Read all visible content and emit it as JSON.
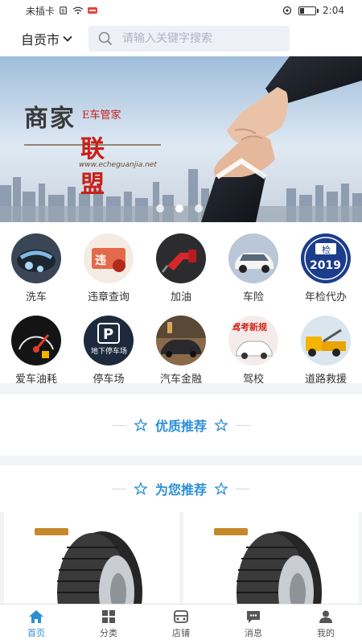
{
  "status_bar": {
    "carrier": "未插卡",
    "time": "2:04",
    "battery_level": 0.3
  },
  "header": {
    "city": "自贡市",
    "search_placeholder": "请输入关键字搜索"
  },
  "banner": {
    "brand_main": "商家",
    "brand_sub": "E车管家",
    "brand_main2": "联盟",
    "brand_url": "www.echeguanjia.net",
    "slide_count": 3,
    "active_slide": 1
  },
  "services": [
    {
      "label": "洗车",
      "icon": "car-wash-icon"
    },
    {
      "label": "违章查询",
      "icon": "violation-icon"
    },
    {
      "label": "加油",
      "icon": "fuel-nozzle-icon"
    },
    {
      "label": "车险",
      "icon": "car-insurance-icon"
    },
    {
      "label": "年检代办",
      "icon": "annual-inspection-icon"
    },
    {
      "label": "爱车油耗",
      "icon": "fuel-gauge-icon"
    },
    {
      "label": "停车场",
      "icon": "parking-icon"
    },
    {
      "label": "汽车金融",
      "icon": "car-finance-icon"
    },
    {
      "label": "驾校",
      "icon": "driving-school-icon"
    },
    {
      "label": "道路救援",
      "icon": "tow-truck-icon"
    }
  ],
  "service_badges": {
    "inspection_year": "2019",
    "inspection_word": "检",
    "parking_text": "地下停车场",
    "parking_letter": "P",
    "driving_school_text": "驾考新规"
  },
  "sections": {
    "quality": "优质推荐",
    "for_you": "为您推荐"
  },
  "tabs": [
    {
      "label": "首页",
      "icon": "home-icon"
    },
    {
      "label": "分类",
      "icon": "grid-icon"
    },
    {
      "label": "店铺",
      "icon": "shop-icon"
    },
    {
      "label": "消息",
      "icon": "message-icon"
    },
    {
      "label": "我的",
      "icon": "user-icon"
    }
  ],
  "colors": {
    "accent": "#2b8fd6",
    "brand_red": "#c8201a"
  }
}
